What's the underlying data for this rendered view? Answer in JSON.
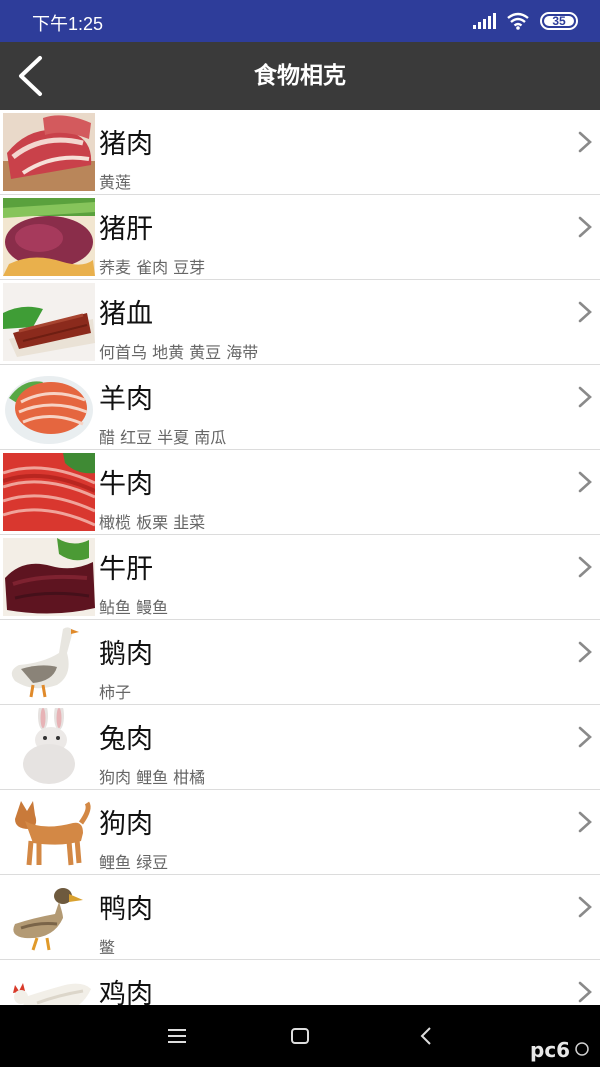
{
  "status": {
    "time": "下午1:25",
    "battery": "35"
  },
  "app": {
    "title": "食物相克"
  },
  "items": [
    {
      "name": "猪肉",
      "conflicts": "黄莲",
      "thumb": "pork-photo"
    },
    {
      "name": "猪肝",
      "conflicts": "荞麦 雀肉 豆芽",
      "thumb": "pork-liver-photo"
    },
    {
      "name": "猪血",
      "conflicts": "何首乌 地黄 黄豆 海带",
      "thumb": "pork-blood-photo"
    },
    {
      "name": "羊肉",
      "conflicts": "醋 红豆 半夏 南瓜",
      "thumb": "lamb-photo"
    },
    {
      "name": "牛肉",
      "conflicts": "橄榄 板栗 韭菜",
      "thumb": "beef-photo"
    },
    {
      "name": "牛肝",
      "conflicts": "鲇鱼 鳗鱼",
      "thumb": "beef-liver-photo"
    },
    {
      "name": "鹅肉",
      "conflicts": "柿子",
      "thumb": "goose-photo"
    },
    {
      "name": "兔肉",
      "conflicts": "狗肉 鲤鱼 柑橘",
      "thumb": "rabbit-photo"
    },
    {
      "name": "狗肉",
      "conflicts": "鲤鱼 绿豆",
      "thumb": "dog-photo"
    },
    {
      "name": "鸭肉",
      "conflicts": "鳖",
      "thumb": "duck-photo"
    },
    {
      "name": "鸡肉",
      "conflicts": "",
      "thumb": "chicken-photo"
    }
  ],
  "watermark": "pc6"
}
